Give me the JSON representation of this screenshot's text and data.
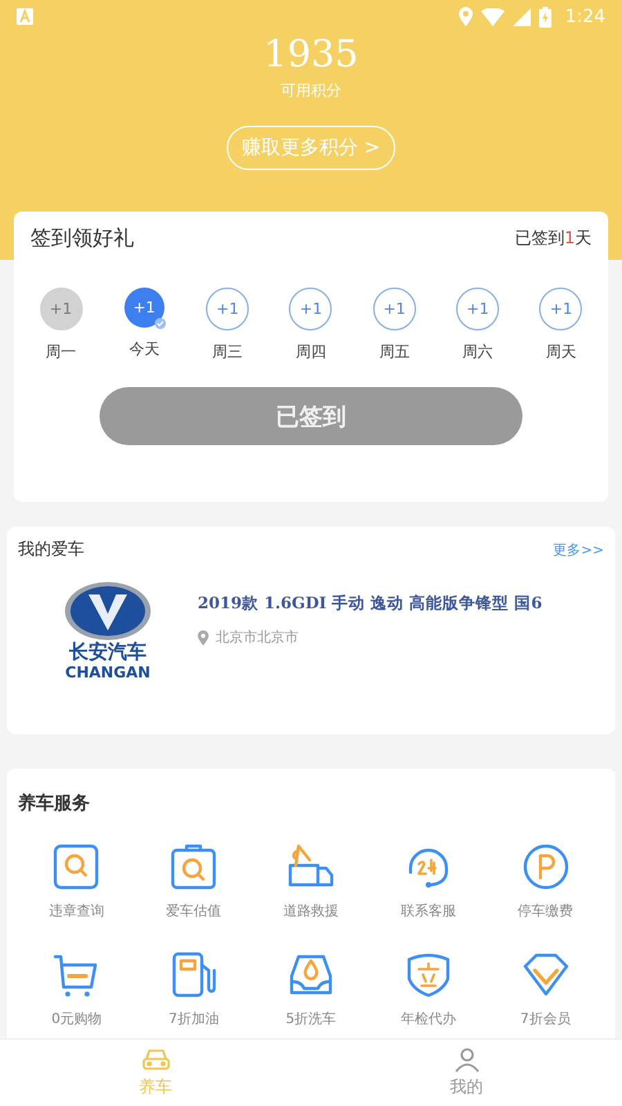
{
  "status_bar": {
    "time": "1:24"
  },
  "points": {
    "value": "1935",
    "label": "可用积分",
    "earn_button": "赚取更多积分 >"
  },
  "checkin": {
    "title": "签到领好礼",
    "summary_prefix": "已签到",
    "summary_count": "1",
    "summary_suffix": "天",
    "days": [
      {
        "badge": "+1",
        "label": "周一",
        "kind": "missed"
      },
      {
        "badge": "+1",
        "label": "今天",
        "kind": "signed"
      },
      {
        "badge": "+1",
        "label": "周三",
        "kind": "upcoming"
      },
      {
        "badge": "+1",
        "label": "周四",
        "kind": "upcoming"
      },
      {
        "badge": "+1",
        "label": "周五",
        "kind": "upcoming"
      },
      {
        "badge": "+1",
        "label": "周六",
        "kind": "upcoming"
      },
      {
        "badge": "+1",
        "label": "周天",
        "kind": "upcoming"
      }
    ],
    "button": {
      "label": "已签到",
      "disabled": true
    }
  },
  "my_car": {
    "title": "我的爱车",
    "more": "更多>>",
    "brand_cn": "长安汽车",
    "brand_en": "CHANGAN",
    "model": "2019款 1.6GDI 手动 逸动 高能版争锋型 国6",
    "location": "北京市北京市"
  },
  "services": {
    "title": "养车服务",
    "items": [
      {
        "label": "违章查询"
      },
      {
        "label": "爱车估值"
      },
      {
        "label": "道路救援"
      },
      {
        "label": "联系客服"
      },
      {
        "label": "停车缴费"
      },
      {
        "label": "0元购物"
      },
      {
        "label": "7折加油"
      },
      {
        "label": "5折洗车"
      },
      {
        "label": "年检代办"
      },
      {
        "label": "7折会员"
      }
    ]
  },
  "bottom_nav": [
    {
      "label": "养车",
      "selected": true
    },
    {
      "label": "我的",
      "selected": false
    }
  ]
}
